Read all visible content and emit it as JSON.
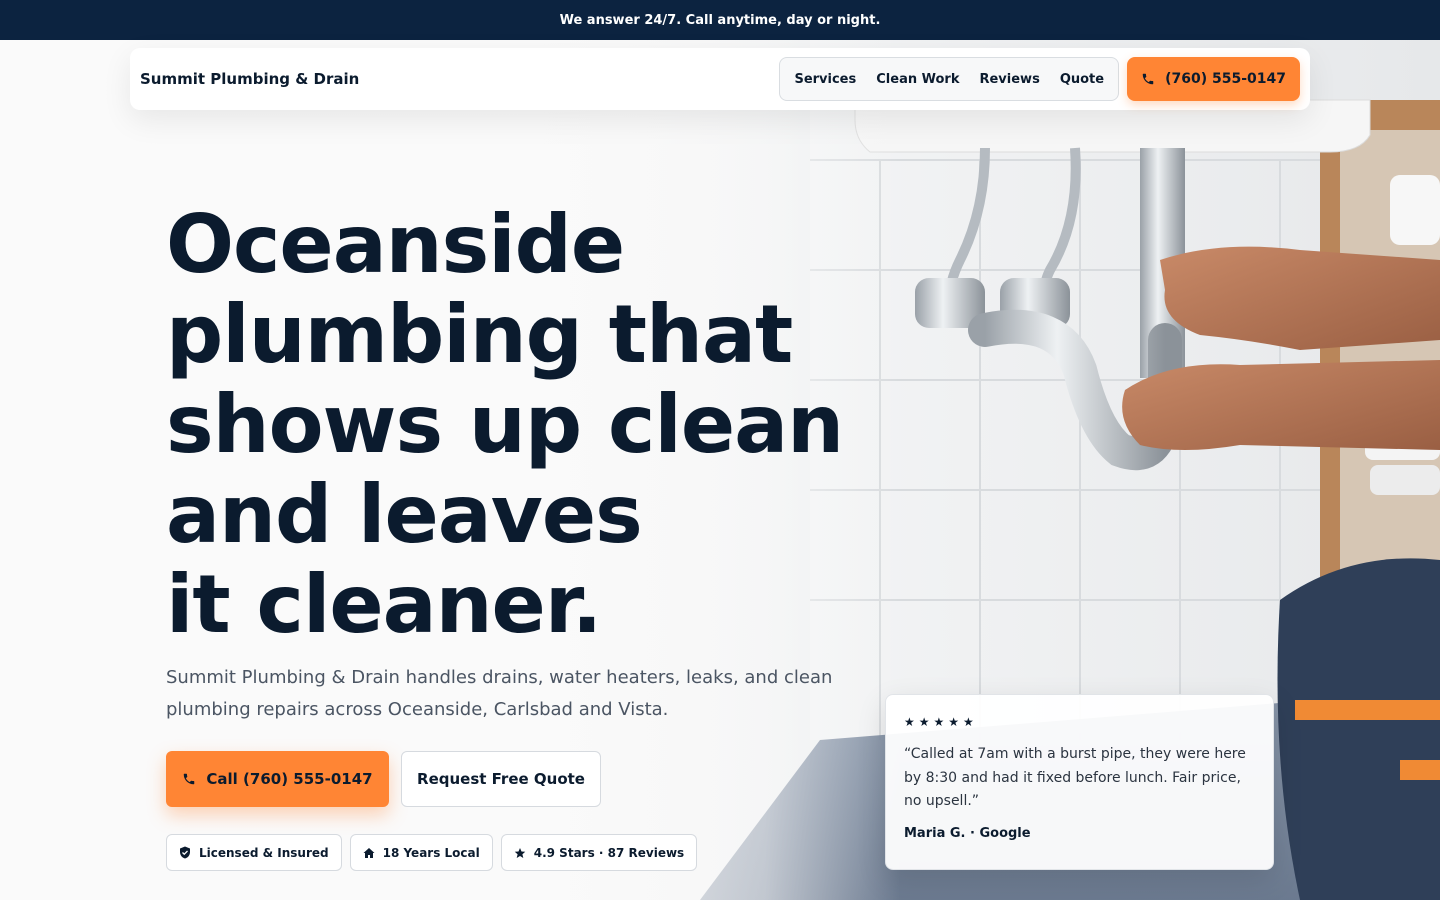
{
  "topbar": {
    "text": "We answer 24/7. Call anytime, day or night."
  },
  "nav": {
    "brand": "Summit Plumbing & Drain",
    "links": [
      "Services",
      "Clean Work",
      "Reviews",
      "Quote"
    ],
    "phone": "(760) 555-0147"
  },
  "hero": {
    "headline_lines": [
      "Oceanside",
      "plumbing that",
      "shows up clean",
      "and leaves",
      "it cleaner."
    ],
    "subtitle": "Summit Plumbing & Drain handles drains, water heaters, leaks, and clean plumbing repairs across Oceanside, Carlsbad and Vista.",
    "call_button": "Call (760) 555-0147",
    "quote_button": "Request Free Quote",
    "badges": [
      {
        "icon": "shield-check-icon",
        "label": "Licensed & Insured"
      },
      {
        "icon": "home-icon",
        "label": "18 Years Local"
      },
      {
        "icon": "star-icon",
        "label": "4.9 Stars · 87 Reviews"
      }
    ]
  },
  "review": {
    "stars": "★★★★★",
    "rating": 5,
    "quote": "“Called at 7am with a burst pipe, they were here by 8:30 and had it fixed before lunch. Fair price, no upsell.”",
    "author": "Maria G. · Google"
  },
  "colors": {
    "navy": "#0c2340",
    "accent": "#ff8534",
    "text": "#0b1b2e"
  }
}
